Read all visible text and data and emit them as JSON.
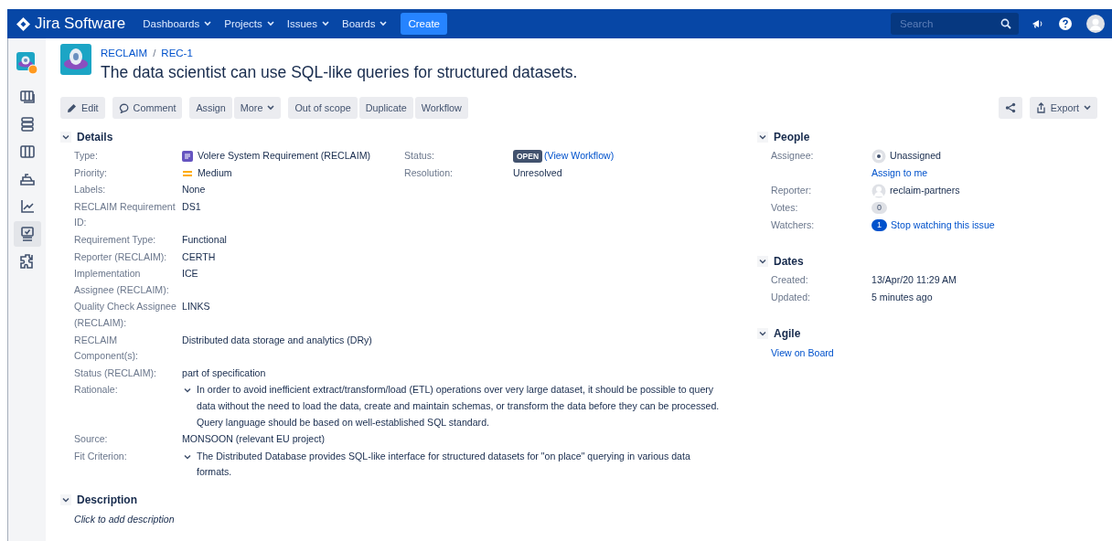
{
  "nav": {
    "product": "Jira Software",
    "menus": [
      {
        "label": "Dashboards"
      },
      {
        "label": "Projects"
      },
      {
        "label": "Issues"
      },
      {
        "label": "Boards"
      }
    ],
    "create": "Create",
    "search": {
      "placeholder": "Search"
    }
  },
  "sidebar": {
    "items": [
      {
        "kind": "project",
        "selected": false
      },
      {
        "kind": "board",
        "selected": false
      },
      {
        "kind": "backlog",
        "selected": false
      },
      {
        "kind": "columns",
        "selected": false
      },
      {
        "kind": "releases",
        "selected": false
      },
      {
        "kind": "reports",
        "selected": false
      },
      {
        "kind": "tests",
        "selected": true
      },
      {
        "kind": "addons",
        "selected": false
      }
    ]
  },
  "issue": {
    "project": "RECLAIM",
    "separator": "/",
    "key": "REC-1",
    "title": "The data scientist can use SQL-like queries for structured datasets."
  },
  "toolbar": {
    "groups": [
      [
        {
          "kind": "edit",
          "label": "Edit"
        }
      ],
      [
        {
          "kind": "comment",
          "label": "Comment"
        }
      ],
      [
        {
          "kind": "plain",
          "label": "Assign"
        },
        {
          "kind": "menu",
          "label": "More"
        }
      ],
      [
        {
          "kind": "plain",
          "label": "Out of scope"
        },
        {
          "kind": "plain",
          "label": "Duplicate"
        },
        {
          "kind": "plain",
          "label": "Workflow"
        }
      ]
    ],
    "right_groups": [
      [
        {
          "kind": "share"
        }
      ],
      [
        {
          "kind": "export",
          "label": "Export"
        }
      ]
    ]
  },
  "details": {
    "title": "Details",
    "expanded": true,
    "fields": [
      {
        "label": "Type:",
        "kind": "type",
        "value": "Volere System Requirement (RECLAIM)"
      },
      {
        "label": "Priority:",
        "kind": "priority",
        "value": "Medium"
      },
      {
        "label": "Labels:",
        "kind": "text",
        "value": "None"
      },
      {
        "label": "RECLAIM Requirement ID:",
        "kind": "text",
        "value": "DS1"
      },
      {
        "label": "Requirement Type:",
        "kind": "text",
        "value": "Functional"
      },
      {
        "label": "Reporter (RECLAIM):",
        "kind": "text",
        "value": "CERTH"
      },
      {
        "label": "Implementation Assignee (RECLAIM):",
        "kind": "text",
        "value": "ICE"
      },
      {
        "label": "Quality Check Assignee (RECLAIM):",
        "kind": "text",
        "value": "LINKS"
      },
      {
        "label": "RECLAIM Component(s):",
        "kind": "text",
        "value": "Distributed data storage and analytics (DRy)"
      },
      {
        "label": "Status (RECLAIM):",
        "kind": "text",
        "value": "part of specification"
      },
      {
        "label": "Rationale:",
        "kind": "collapsible",
        "expanded": true,
        "value": "In order to avoid inefficient extract/transform/load (ETL) operations over very large dataset, it should be possible to query data without the need to load the data, create and maintain schemas, or transform the data before they can be processed. Query language should be based on well-established SQL standard."
      },
      {
        "label": "Source:",
        "kind": "text",
        "value": "MONSOON (relevant EU project)"
      },
      {
        "label": "Fit Criterion:",
        "kind": "collapsible",
        "expanded": true,
        "value": "The Distributed Database provides SQL-like interface for structured datasets for \"on place\" querying in various data formats."
      }
    ],
    "side_fields": [
      {
        "label": "Status:",
        "kind": "status",
        "badge": "OPEN",
        "link": "(View Workflow)"
      },
      {
        "label": "Resolution:",
        "kind": "text",
        "value": "Unresolved"
      }
    ]
  },
  "description": {
    "title": "Description",
    "expanded": true,
    "hint": "Click to add description"
  },
  "people": {
    "title": "People",
    "expanded": true,
    "fields": [
      {
        "label": "Assignee:",
        "kind": "unassigned",
        "value": "Unassigned",
        "link": "Assign to me"
      },
      {
        "label": "Reporter:",
        "kind": "user",
        "value": "reclaim-partners"
      },
      {
        "label": "Votes:",
        "kind": "count",
        "count": "0"
      },
      {
        "label": "Watchers:",
        "kind": "watch",
        "count": "1",
        "link": "Stop watching this issue"
      }
    ]
  },
  "dates": {
    "title": "Dates",
    "expanded": true,
    "fields": [
      {
        "label": "Created:",
        "kind": "text",
        "value": "13/Apr/20 11:29 AM"
      },
      {
        "label": "Updated:",
        "kind": "text",
        "value": "5 minutes ago"
      }
    ]
  },
  "agile": {
    "title": "Agile",
    "expanded": true,
    "link": "View on Board"
  }
}
